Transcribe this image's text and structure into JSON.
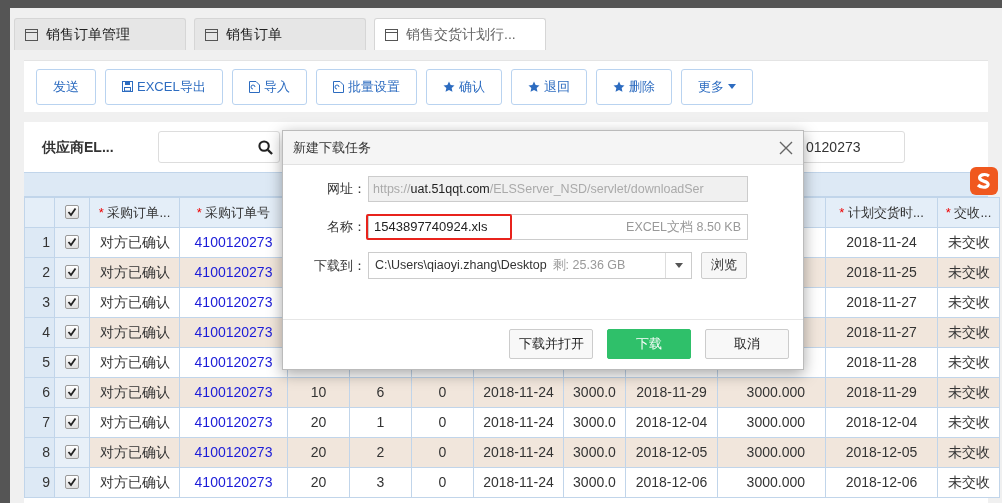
{
  "tabs": [
    {
      "label": "销售订单管理",
      "selected": false
    },
    {
      "label": "销售订单",
      "selected": false
    },
    {
      "label": "销售交货计划行...",
      "selected": true
    }
  ],
  "toolbar": [
    {
      "label": "发送",
      "kind": "plain"
    },
    {
      "label": "EXCEL导出",
      "kind": "save"
    },
    {
      "label": "导入",
      "kind": "import"
    },
    {
      "label": "批量设置",
      "kind": "import"
    },
    {
      "label": "确认",
      "kind": "star"
    },
    {
      "label": "退回",
      "kind": "star"
    },
    {
      "label": "删除",
      "kind": "star"
    },
    {
      "label": "更多",
      "kind": "dropdown"
    }
  ],
  "filter": {
    "label": "供应商EL...",
    "order_field": {
      "value": "0120273"
    }
  },
  "table": {
    "header_checked": true,
    "columns": [
      {
        "marker": "*",
        "label": "采购订单..."
      },
      {
        "marker": "*",
        "label": "采购订单号"
      },
      null,
      null,
      null,
      null,
      null,
      null,
      null,
      {
        "marker": "*",
        "label": "计划交货时..."
      },
      {
        "marker": "*",
        "label": "交收..."
      }
    ],
    "rows": [
      {
        "index": "1",
        "checked": true,
        "cells": [
          "对方已确认",
          "4100120273",
          null,
          null,
          null,
          null,
          null,
          null,
          null,
          "2018-11-24",
          "未交收"
        ]
      },
      {
        "index": "2",
        "checked": true,
        "cells": [
          "对方已确认",
          "4100120273",
          null,
          null,
          null,
          null,
          null,
          null,
          null,
          "2018-11-25",
          "未交收"
        ]
      },
      {
        "index": "3",
        "checked": true,
        "cells": [
          "对方已确认",
          "4100120273",
          null,
          null,
          null,
          null,
          null,
          null,
          null,
          "2018-11-27",
          "未交收"
        ]
      },
      {
        "index": "4",
        "checked": true,
        "cells": [
          "对方已确认",
          "4100120273",
          null,
          null,
          null,
          null,
          null,
          null,
          null,
          "2018-11-27",
          "未交收"
        ]
      },
      {
        "index": "5",
        "checked": true,
        "cells": [
          "对方已确认",
          "4100120273",
          null,
          null,
          null,
          null,
          null,
          null,
          null,
          "2018-11-28",
          "未交收"
        ]
      },
      {
        "index": "6",
        "checked": true,
        "cells": [
          "对方已确认",
          "4100120273",
          "10",
          "6",
          "0",
          "2018-11-24",
          "3000.0",
          "2018-11-29",
          "3000.000",
          "2018-11-29",
          "未交收"
        ]
      },
      {
        "index": "7",
        "checked": true,
        "cells": [
          "对方已确认",
          "4100120273",
          "20",
          "1",
          "0",
          "2018-11-24",
          "3000.0",
          "2018-12-04",
          "3000.000",
          "2018-12-04",
          "未交收"
        ]
      },
      {
        "index": "8",
        "checked": true,
        "cells": [
          "对方已确认",
          "4100120273",
          "20",
          "2",
          "0",
          "2018-11-24",
          "3000.0",
          "2018-12-05",
          "3000.000",
          "2018-12-05",
          "未交收"
        ]
      },
      {
        "index": "9",
        "checked": true,
        "cells": [
          "对方已确认",
          "4100120273",
          "20",
          "3",
          "0",
          "2018-11-24",
          "3000.0",
          "2018-12-06",
          "3000.000",
          "2018-12-06",
          "未交收"
        ]
      }
    ]
  },
  "dialog": {
    "title": "新建下载任务",
    "url": {
      "label": "网址：",
      "scheme": "https://",
      "host": "uat.51qqt.com",
      "path": "/ELSServer_NSD/servlet/downloadSer"
    },
    "name": {
      "label": "名称：",
      "value": "1543897740924.xls",
      "file_info": "EXCEL文档 8.50 KB",
      "highlighted": true
    },
    "target": {
      "label": "下载到：",
      "path": "C:\\Users\\qiaoyi.zhang\\Desktop",
      "free_space": "剩: 25.36 GB",
      "browse": "浏览"
    },
    "buttons": [
      {
        "label": "下载并打开",
        "kind": "secondary"
      },
      {
        "label": "下载",
        "kind": "primary"
      },
      {
        "label": "取消",
        "kind": "secondary"
      }
    ]
  }
}
